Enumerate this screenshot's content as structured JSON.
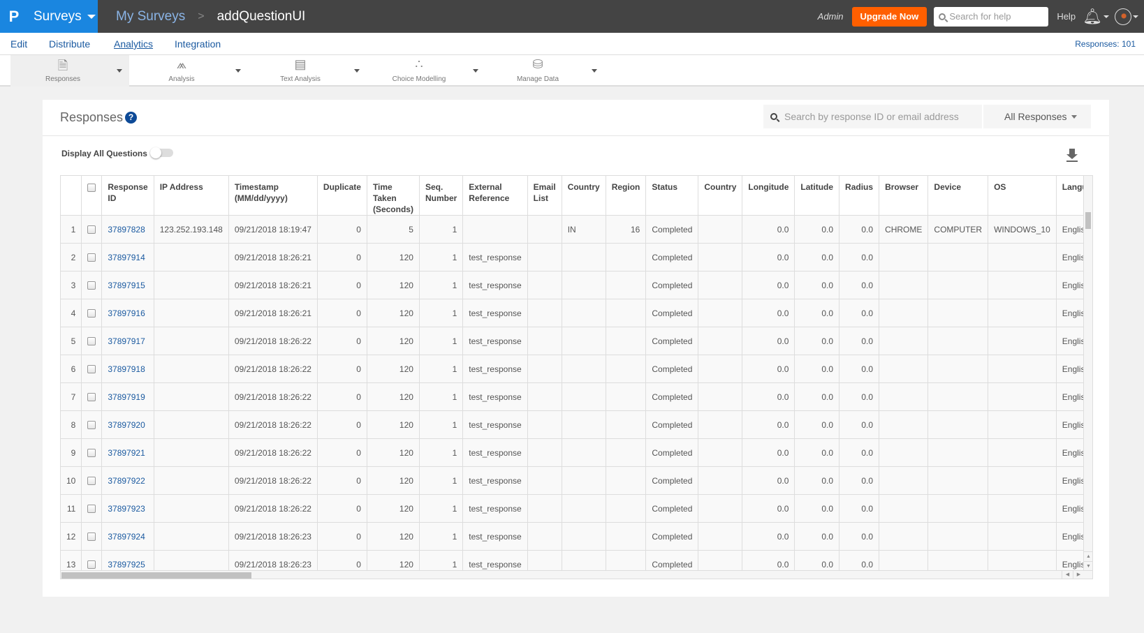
{
  "topbar": {
    "logo": "P",
    "app_name": "Surveys",
    "breadcrumb_root": "My Surveys",
    "breadcrumb_sep": ">",
    "breadcrumb_current": "addQuestionUI",
    "user_role": "Admin",
    "upgrade_label": "Upgrade Now",
    "help_search_placeholder": "Search for help",
    "help_label": "Help",
    "accent_color": "#1a86e0",
    "upgrade_color": "#ff5f00"
  },
  "nav": {
    "tabs": [
      {
        "label": "Edit"
      },
      {
        "label": "Distribute"
      },
      {
        "label": "Analytics",
        "active": true
      },
      {
        "label": "Integration"
      }
    ],
    "responses_count": "Responses: 101"
  },
  "toolbar": {
    "items": [
      {
        "label": "Responses",
        "icon": "responses-icon",
        "active": true
      },
      {
        "label": "Analysis",
        "icon": "analysis-chart-icon"
      },
      {
        "label": "Text Analysis",
        "icon": "text-analysis-icon"
      },
      {
        "label": "Choice Modelling",
        "icon": "choice-modelling-icon"
      },
      {
        "label": "Manage Data",
        "icon": "database-icon"
      }
    ]
  },
  "panel": {
    "title": "Responses",
    "help_icon": "?",
    "search_placeholder": "Search by response ID or email address",
    "filter_selected": "All Responses",
    "display_all_label": "Display All Questions",
    "display_all_on": false
  },
  "table": {
    "columns": [
      "",
      "",
      "Response ID",
      "IP Address",
      "Timestamp (MM/dd/yyyy)",
      "Duplicate",
      "Time Taken (Seconds)",
      "Seq. Number",
      "External Reference",
      "Email List",
      "Country",
      "Region",
      "Status",
      "Country",
      "Longitude",
      "Latitude",
      "Radius",
      "Browser",
      "Device",
      "OS",
      "Language"
    ],
    "rows": [
      [
        "1",
        "",
        "37897828",
        "123.252.193.148",
        "09/21/2018 18:19:47",
        "0",
        "5",
        "1",
        "",
        "",
        "IN",
        "16",
        "Completed",
        "",
        "0.0",
        "0.0",
        "0.0",
        "CHROME",
        "COMPUTER",
        "WINDOWS_10",
        "English"
      ],
      [
        "2",
        "",
        "37897914",
        "",
        "09/21/2018 18:26:21",
        "0",
        "120",
        "1",
        "test_response",
        "",
        "",
        "",
        "Completed",
        "",
        "0.0",
        "0.0",
        "0.0",
        "",
        "",
        "",
        "English"
      ],
      [
        "3",
        "",
        "37897915",
        "",
        "09/21/2018 18:26:21",
        "0",
        "120",
        "1",
        "test_response",
        "",
        "",
        "",
        "Completed",
        "",
        "0.0",
        "0.0",
        "0.0",
        "",
        "",
        "",
        "English"
      ],
      [
        "4",
        "",
        "37897916",
        "",
        "09/21/2018 18:26:21",
        "0",
        "120",
        "1",
        "test_response",
        "",
        "",
        "",
        "Completed",
        "",
        "0.0",
        "0.0",
        "0.0",
        "",
        "",
        "",
        "English"
      ],
      [
        "5",
        "",
        "37897917",
        "",
        "09/21/2018 18:26:22",
        "0",
        "120",
        "1",
        "test_response",
        "",
        "",
        "",
        "Completed",
        "",
        "0.0",
        "0.0",
        "0.0",
        "",
        "",
        "",
        "English"
      ],
      [
        "6",
        "",
        "37897918",
        "",
        "09/21/2018 18:26:22",
        "0",
        "120",
        "1",
        "test_response",
        "",
        "",
        "",
        "Completed",
        "",
        "0.0",
        "0.0",
        "0.0",
        "",
        "",
        "",
        "English"
      ],
      [
        "7",
        "",
        "37897919",
        "",
        "09/21/2018 18:26:22",
        "0",
        "120",
        "1",
        "test_response",
        "",
        "",
        "",
        "Completed",
        "",
        "0.0",
        "0.0",
        "0.0",
        "",
        "",
        "",
        "English"
      ],
      [
        "8",
        "",
        "37897920",
        "",
        "09/21/2018 18:26:22",
        "0",
        "120",
        "1",
        "test_response",
        "",
        "",
        "",
        "Completed",
        "",
        "0.0",
        "0.0",
        "0.0",
        "",
        "",
        "",
        "English"
      ],
      [
        "9",
        "",
        "37897921",
        "",
        "09/21/2018 18:26:22",
        "0",
        "120",
        "1",
        "test_response",
        "",
        "",
        "",
        "Completed",
        "",
        "0.0",
        "0.0",
        "0.0",
        "",
        "",
        "",
        "English"
      ],
      [
        "10",
        "",
        "37897922",
        "",
        "09/21/2018 18:26:22",
        "0",
        "120",
        "1",
        "test_response",
        "",
        "",
        "",
        "Completed",
        "",
        "0.0",
        "0.0",
        "0.0",
        "",
        "",
        "",
        "English"
      ],
      [
        "11",
        "",
        "37897923",
        "",
        "09/21/2018 18:26:22",
        "0",
        "120",
        "1",
        "test_response",
        "",
        "",
        "",
        "Completed",
        "",
        "0.0",
        "0.0",
        "0.0",
        "",
        "",
        "",
        "English"
      ],
      [
        "12",
        "",
        "37897924",
        "",
        "09/21/2018 18:26:23",
        "0",
        "120",
        "1",
        "test_response",
        "",
        "",
        "",
        "Completed",
        "",
        "0.0",
        "0.0",
        "0.0",
        "",
        "",
        "",
        "English"
      ],
      [
        "13",
        "",
        "37897925",
        "",
        "09/21/2018 18:26:23",
        "0",
        "120",
        "1",
        "test_response",
        "",
        "",
        "",
        "Completed",
        "",
        "0.0",
        "0.0",
        "0.0",
        "",
        "",
        "",
        "English"
      ]
    ]
  }
}
